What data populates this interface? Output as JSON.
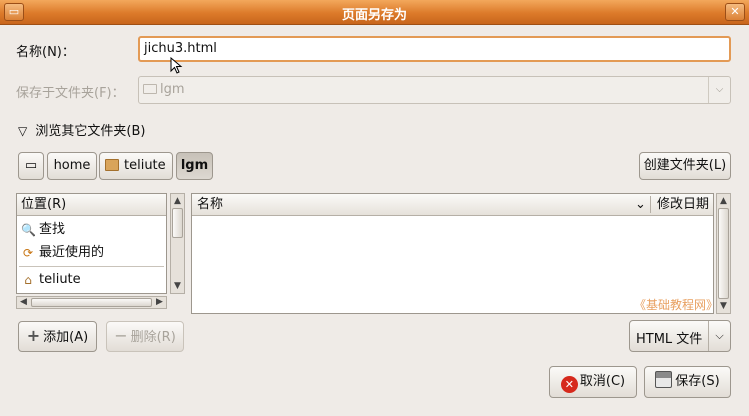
{
  "window": {
    "title": "页面另存为",
    "menu_glyph": "▭",
    "close_glyph": "✕"
  },
  "name_row": {
    "label": "名称(N)：",
    "value": "jichu3.html"
  },
  "save_in": {
    "label": "保存于文件夹(F)：",
    "value": "lgm",
    "arrow": "⌵"
  },
  "browse": {
    "label": "浏览其它文件夹(B)",
    "expanded_glyph": "▽"
  },
  "path_bar": {
    "items": [
      "home",
      "teliute",
      "lgm"
    ],
    "drive_glyph": "▭",
    "create_folder": "创建文件夹(L)"
  },
  "places": {
    "header": "位置(R)",
    "items": [
      {
        "label": "查找",
        "icon": "search-icon",
        "glyph": "🔍"
      },
      {
        "label": "最近使用的",
        "icon": "recent-icon",
        "glyph": "⟳"
      },
      {
        "label": "teliute",
        "icon": "home-folder-icon",
        "glyph": "⌂"
      }
    ]
  },
  "files": {
    "headers": {
      "name": "名称",
      "modified": "修改日期",
      "sort_glyph": "⌄"
    },
    "rows": []
  },
  "watermark": "《基础教程网》",
  "buttons": {
    "add": "添加(A)",
    "remove": "删除(R)",
    "cancel": "取消(C)",
    "save": "保存(S)"
  },
  "filter": {
    "value": "HTML 文件",
    "arrow": "⌵"
  },
  "colors": {
    "title_bar": "#dc7a2a",
    "entry_focus": "#e39a55",
    "window_bg": "#efebe7"
  }
}
